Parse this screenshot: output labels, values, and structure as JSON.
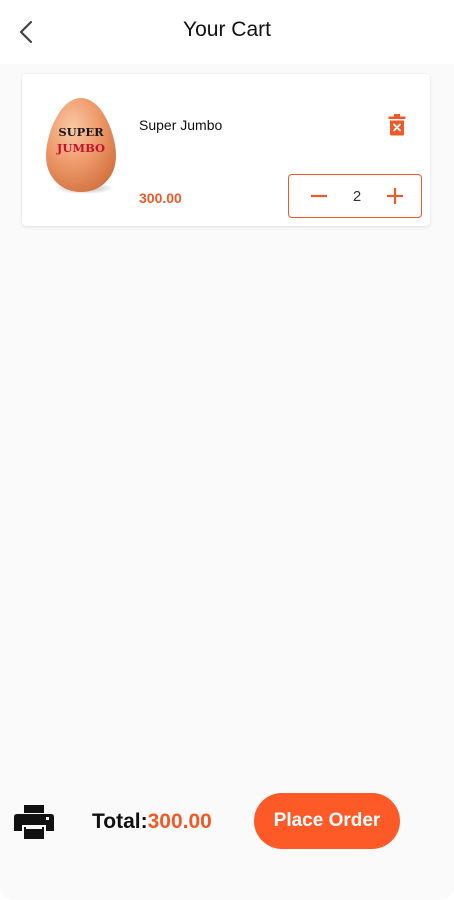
{
  "header": {
    "title": "Your Cart",
    "back_icon": "chevron-left-icon"
  },
  "cart": {
    "items": [
      {
        "name": "Super Jumbo",
        "price": "300.00",
        "quantity": "2",
        "image_text_line1": "SUPER",
        "image_text_line2": "JUMBO",
        "delete_icon": "trash-icon",
        "decrement_icon": "minus-icon",
        "increment_icon": "plus-icon"
      }
    ]
  },
  "footer": {
    "print_icon": "printer-icon",
    "total_label": "Total:",
    "total_value": "300.00",
    "place_order_label": "Place Order"
  },
  "colors": {
    "accent": "#f15a24",
    "button": "#fe5a28",
    "background": "#fafafa",
    "text": "#111111"
  }
}
